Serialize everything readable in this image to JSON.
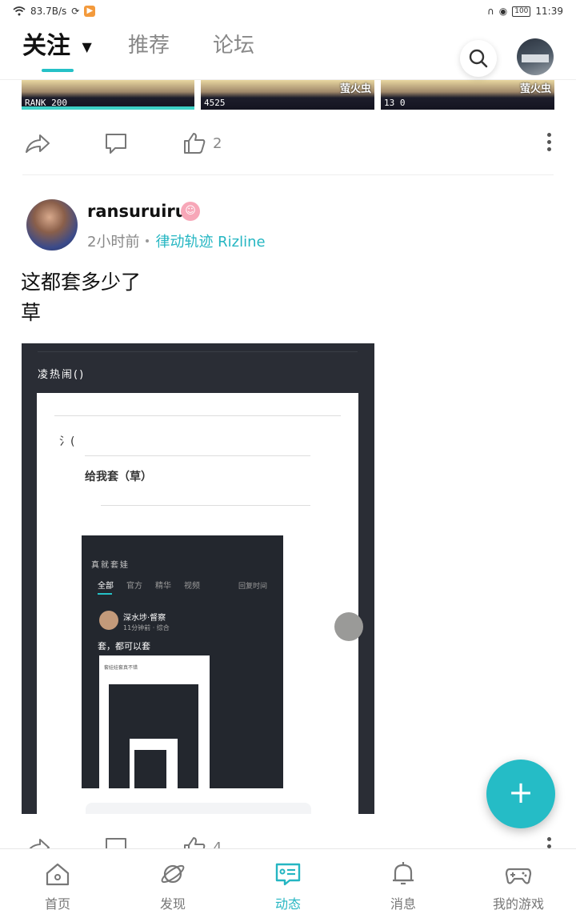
{
  "status_bar": {
    "net_speed": "83.7B/s",
    "battery": "100",
    "time": "11:39"
  },
  "top_nav": {
    "tabs": [
      {
        "label": "关注",
        "active": true
      },
      {
        "label": "推荐",
        "active": false
      },
      {
        "label": "论坛",
        "active": false
      }
    ],
    "accent_color": "#25c1c7"
  },
  "prev_post": {
    "thumbnails": [
      {
        "label": "",
        "bottom_text": "RANK 200"
      },
      {
        "label": "萤火虫",
        "bottom_text": "4525"
      },
      {
        "label": "萤火虫",
        "bottom_text": "13 0"
      }
    ],
    "actions": {
      "like_count": "2"
    }
  },
  "post": {
    "username": "ransuruiru",
    "time": "2小时前",
    "forum": "律动轨迹 Rizline",
    "text_lines": [
      "这都套多少了",
      "草"
    ],
    "image": {
      "outer_header": "凌热闹()",
      "card_text_1": "氵(",
      "card_text_2": "给我套（草）",
      "inner_title": "真就套娃",
      "inner_tabs": [
        "全部",
        "官方",
        "精华",
        "视频"
      ],
      "inner_sort": "回复时间",
      "inner_username": "深水埗·督察",
      "inner_meta": "11分钟前 · 综合",
      "inner_body": "套，都可以套",
      "nested_caption": "套娃娃套真不错"
    },
    "actions": {
      "like_count": "4"
    }
  },
  "fab": {
    "label": "+"
  },
  "bottom_nav": [
    {
      "label": "首页",
      "icon": "home-icon",
      "active": false
    },
    {
      "label": "发现",
      "icon": "planet-icon",
      "active": false
    },
    {
      "label": "动态",
      "icon": "feed-icon",
      "active": true
    },
    {
      "label": "消息",
      "icon": "bell-icon",
      "active": false
    },
    {
      "label": "我的游戏",
      "icon": "gamepad-icon",
      "active": false
    }
  ]
}
